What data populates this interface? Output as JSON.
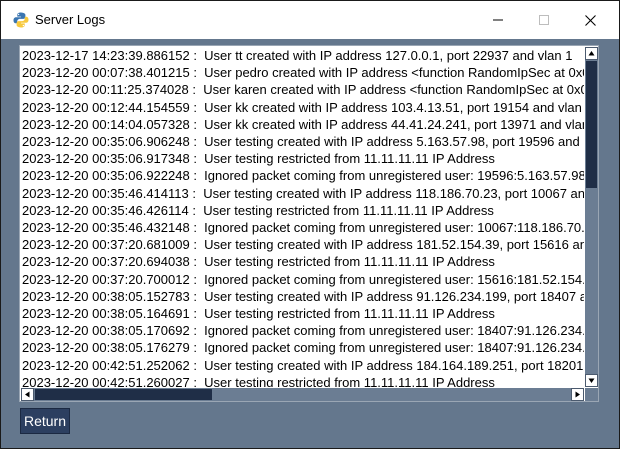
{
  "window": {
    "title": "Server Logs",
    "app_icon": "python-logo-icon"
  },
  "titlebar_controls": [
    "minimize-icon",
    "maximize-icon",
    "close-icon"
  ],
  "log": {
    "lines": [
      "2023-12-17 14:23:39.886152 :  User tt created with IP address 127.0.0.1, port 22937 and vlan 1",
      "2023-12-20 00:07:38.401215 :  User pedro created with IP address <function RandomIpSec at 0x0",
      "2023-12-20 00:11:25.374028 :  User karen created with IP address <function RandomIpSec at 0x0",
      "2023-12-20 00:12:44.154559 :  User kk created with IP address 103.4.13.51, port 19154 and vlan",
      "2023-12-20 00:14:04.057328 :  User kk created with IP address 44.41.24.241, port 13971 and vlan",
      "2023-12-20 00:35:06.906248 :  User testing created with IP address 5.163.57.98, port 19596 and",
      "2023-12-20 00:35:06.917348 :  User testing restricted from 11.11.11.11 IP Address",
      "2023-12-20 00:35:06.922248 :  Ignored packet coming from unregistered user: 19596:5.163.57.98",
      "2023-12-20 00:35:46.414113 :  User testing created with IP address 118.186.70.23, port 10067 an",
      "2023-12-20 00:35:46.426114 :  User testing restricted from 11.11.11.11 IP Address",
      "2023-12-20 00:35:46.432148 :  Ignored packet coming from unregistered user: 10067:118.186.70.2",
      "2023-12-20 00:37:20.681009 :  User testing created with IP address 181.52.154.39, port 15616 an",
      "2023-12-20 00:37:20.694038 :  User testing restricted from 11.11.11.11 IP Address",
      "2023-12-20 00:37:20.700012 :  Ignored packet coming from unregistered user: 15616:181.52.154.",
      "2023-12-20 00:38:05.152783 :  User testing created with IP address 91.126.234.199, port 18407 a",
      "2023-12-20 00:38:05.164691 :  User testing restricted from 11.11.11.11 IP Address",
      "2023-12-20 00:38:05.170692 :  Ignored packet coming from unregistered user: 18407:91.126.234.",
      "2023-12-20 00:38:05.176279 :  Ignored packet coming from unregistered user: 18407:91.126.234.",
      "2023-12-20 00:42:51.252062 :  User testing created with IP address 184.164.189.251, port 18201",
      "2023-12-20 00:42:51.260027 :  User testing restricted from 11.11.11.11 IP Address"
    ]
  },
  "buttons": {
    "return_label": "Return"
  },
  "colors": {
    "window_bg": "#64778d",
    "scrollbar_thumb": "#1f2e47",
    "button_bg": "#2c3f60"
  }
}
